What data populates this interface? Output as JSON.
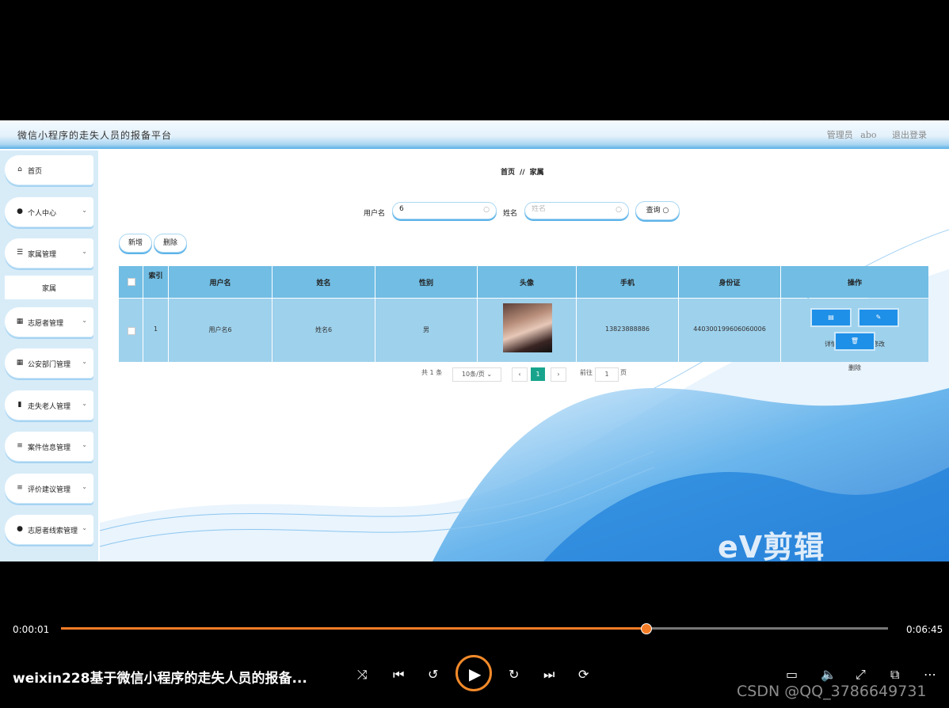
{
  "app": {
    "title": "微信小程序的走失人员的报备平台",
    "role": "管理员",
    "username": "abo",
    "logout": "退出登录"
  },
  "sidebar": {
    "items": [
      {
        "label": "首页",
        "icon": "home-icon"
      },
      {
        "label": "个人中心",
        "icon": "user-icon"
      },
      {
        "label": "家属管理",
        "icon": "sliders-icon"
      },
      {
        "label": "志愿者管理",
        "icon": "grid-icon"
      },
      {
        "label": "公安部门管理",
        "icon": "grid-icon"
      },
      {
        "label": "走失老人管理",
        "icon": "briefcase-icon"
      },
      {
        "label": "案件信息管理",
        "icon": "list-icon"
      },
      {
        "label": "评价建议管理",
        "icon": "list-icon"
      },
      {
        "label": "志愿者线索管理",
        "icon": "pin-icon"
      }
    ],
    "sub_item": "家属"
  },
  "breadcrumb": {
    "home": "首页",
    "sep": "//",
    "current": "家属"
  },
  "search": {
    "username_label": "用户名",
    "username_value": "6",
    "name_label": "姓名",
    "name_placeholder": "姓名",
    "query_button": "查询"
  },
  "actions": {
    "add": "新增",
    "delete": "删除"
  },
  "table": {
    "headers": {
      "index": "索引",
      "username": "用户名",
      "name": "姓名",
      "gender": "性别",
      "avatar": "头像",
      "phone": "手机",
      "id_card": "身份证",
      "ops": "操作"
    },
    "rows": [
      {
        "index": "1",
        "username": "用户名6",
        "name": "姓名6",
        "gender": "男",
        "phone": "13823888886",
        "id_card": "440300199606060006"
      }
    ],
    "op_labels": {
      "detail": "详情",
      "edit": "修改",
      "delete": "删除"
    }
  },
  "pagination": {
    "total_prefix": "共",
    "total": "1",
    "total_suffix": "条",
    "page_size": "10条/页",
    "current": "1",
    "goto_label": "前往",
    "goto_value": "1",
    "goto_suffix": "页"
  },
  "watermark": "eV剪辑",
  "player": {
    "current_time": "0:00:01",
    "total_time": "0:06:45",
    "progress": 0.707,
    "title": "weixin228基于微信小程序的走失人员的报备...",
    "watermark": "CSDN @QQ_3786649731"
  },
  "colors": {
    "accent": "#f57c26",
    "table_header": "#71bde4",
    "table_row": "#9ed1ec",
    "op_button": "#1e90e8",
    "pager_active": "#18a48c"
  }
}
